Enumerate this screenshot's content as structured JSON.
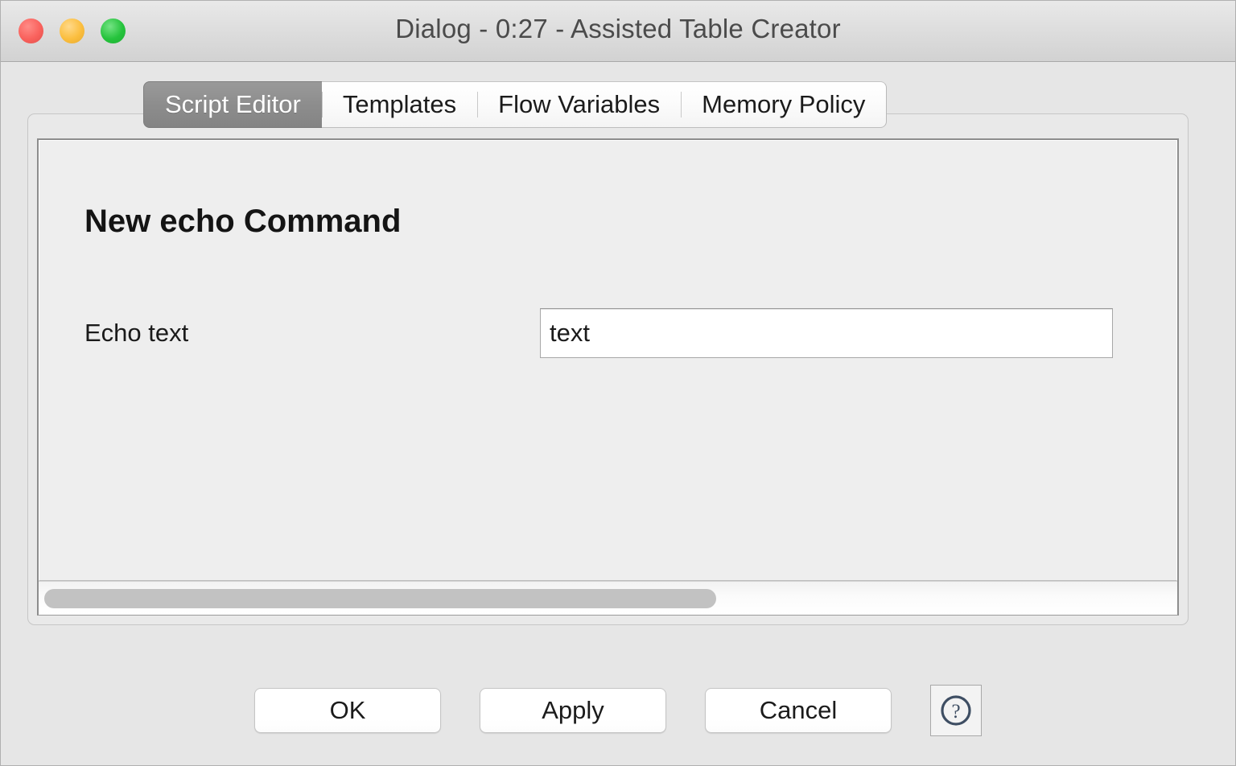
{
  "window": {
    "title": "Dialog - 0:27 - Assisted Table Creator",
    "traffic_lights": [
      {
        "name": "close",
        "color": "#f9615c"
      },
      {
        "name": "minimize",
        "color": "#fbbe3e"
      },
      {
        "name": "zoom",
        "color": "#25c33c"
      }
    ]
  },
  "tabs": [
    {
      "label": "Script Editor",
      "selected": true
    },
    {
      "label": "Templates",
      "selected": false
    },
    {
      "label": "Flow Variables",
      "selected": false
    },
    {
      "label": "Memory Policy",
      "selected": false
    }
  ],
  "panel": {
    "heading": "New echo Command",
    "fields": [
      {
        "label": "Echo text",
        "value": "text",
        "placeholder": ""
      }
    ],
    "scrollbar": {
      "orientation": "horizontal",
      "thumb_fraction": "59%"
    }
  },
  "footer": {
    "buttons": [
      {
        "label": "OK",
        "name": "ok-button"
      },
      {
        "label": "Apply",
        "name": "apply-button"
      },
      {
        "label": "Cancel",
        "name": "cancel-button"
      }
    ],
    "help": {
      "icon": "question-mark-circle-icon",
      "color": "#3e4e63"
    }
  },
  "colors": {
    "titlebar": "#dcdcdc",
    "dialog_background": "#e6e6e6",
    "content_background": "#eeeeee",
    "selected_tab": "#8d8d8d",
    "scrollbar_thumb": "#c2c2c2"
  }
}
